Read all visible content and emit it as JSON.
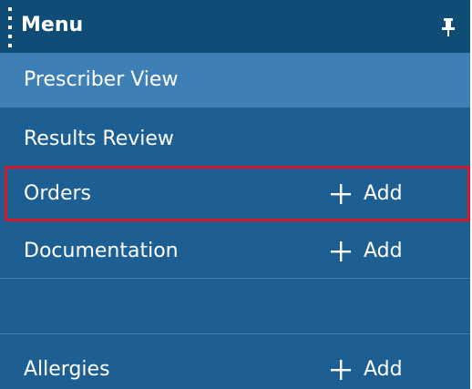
{
  "menu": {
    "title": "Menu",
    "pin_icon": "pin-icon",
    "grip_icon": "drag-handle-icon"
  },
  "items": [
    {
      "label": "Prescriber View",
      "selected": true,
      "add_label": ""
    },
    {
      "label": "Results Review",
      "selected": false,
      "add_label": ""
    },
    {
      "label": "Orders",
      "selected": false,
      "add_label": "Add",
      "highlighted": true
    },
    {
      "label": "Documentation",
      "selected": false,
      "add_label": "Add"
    },
    {
      "label": "",
      "selected": false,
      "add_label": ""
    },
    {
      "label": "Allergies",
      "selected": false,
      "add_label": "Add"
    }
  ],
  "colors": {
    "header_bg": "#0f4d76",
    "panel_bg": "#1e5f93",
    "selected_bg": "#3e7fb5",
    "highlight_border": "#d41a2a",
    "text": "#ffffff"
  }
}
